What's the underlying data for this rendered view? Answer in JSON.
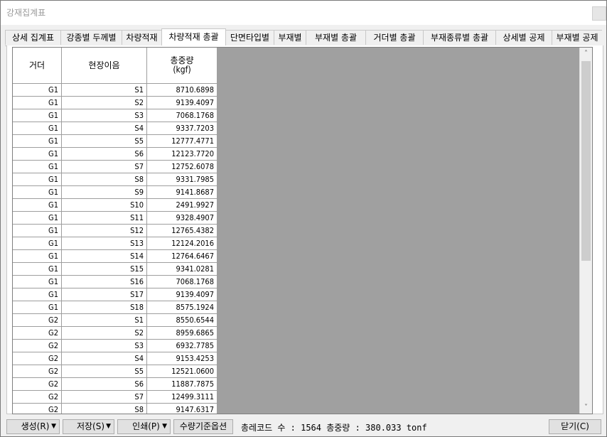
{
  "window": {
    "title": "강재집계표"
  },
  "tabs": [
    {
      "label": "상세 집계표",
      "active": false
    },
    {
      "label": "강종별 두께별",
      "active": false
    },
    {
      "label": "차량적재",
      "active": false
    },
    {
      "label": "차량적재 총괄",
      "active": true
    },
    {
      "label": "단면타입별",
      "active": false
    },
    {
      "label": "부재별",
      "active": false
    },
    {
      "label": "부재별 총괄",
      "active": false
    },
    {
      "label": "거더별 총괄",
      "active": false
    },
    {
      "label": "부재종류별 총괄",
      "active": false
    },
    {
      "label": "상세별 공제",
      "active": false
    },
    {
      "label": "부재별 공제",
      "active": false
    }
  ],
  "grid": {
    "headers": {
      "girder": "거더",
      "site_name": "현장이음",
      "weight": "총중량",
      "weight_unit": "(kgf)"
    },
    "rows": [
      [
        "G1",
        "S1",
        "8710.6898"
      ],
      [
        "G1",
        "S2",
        "9139.4097"
      ],
      [
        "G1",
        "S3",
        "7068.1768"
      ],
      [
        "G1",
        "S4",
        "9337.7203"
      ],
      [
        "G1",
        "S5",
        "12777.4771"
      ],
      [
        "G1",
        "S6",
        "12123.7720"
      ],
      [
        "G1",
        "S7",
        "12752.6078"
      ],
      [
        "G1",
        "S8",
        "9331.7985"
      ],
      [
        "G1",
        "S9",
        "9141.8687"
      ],
      [
        "G1",
        "S10",
        "2491.9927"
      ],
      [
        "G1",
        "S11",
        "9328.4907"
      ],
      [
        "G1",
        "S12",
        "12765.4382"
      ],
      [
        "G1",
        "S13",
        "12124.2016"
      ],
      [
        "G1",
        "S14",
        "12764.6467"
      ],
      [
        "G1",
        "S15",
        "9341.0281"
      ],
      [
        "G1",
        "S16",
        "7068.1768"
      ],
      [
        "G1",
        "S17",
        "9139.4097"
      ],
      [
        "G1",
        "S18",
        "8575.1924"
      ],
      [
        "G2",
        "S1",
        "8550.6544"
      ],
      [
        "G2",
        "S2",
        "8959.6865"
      ],
      [
        "G2",
        "S3",
        "6932.7785"
      ],
      [
        "G2",
        "S4",
        "9153.4253"
      ],
      [
        "G2",
        "S5",
        "12521.0600"
      ],
      [
        "G2",
        "S6",
        "11887.7875"
      ],
      [
        "G2",
        "S7",
        "12499.3111"
      ],
      [
        "G2",
        "S8",
        "9147.6317"
      ]
    ]
  },
  "footer": {
    "create_label": "생성(R)",
    "save_label": "저장(S)",
    "print_label": "인쇄(P)",
    "qty_option_label": "수량기준옵션",
    "summary": "총레코드 수 : 1564 총중량 : 380.033 tonf",
    "close_label": "닫기(C)"
  },
  "scrollbar": {
    "up_icon": "chevron-up-icon",
    "down_icon": "chevron-down-icon"
  }
}
